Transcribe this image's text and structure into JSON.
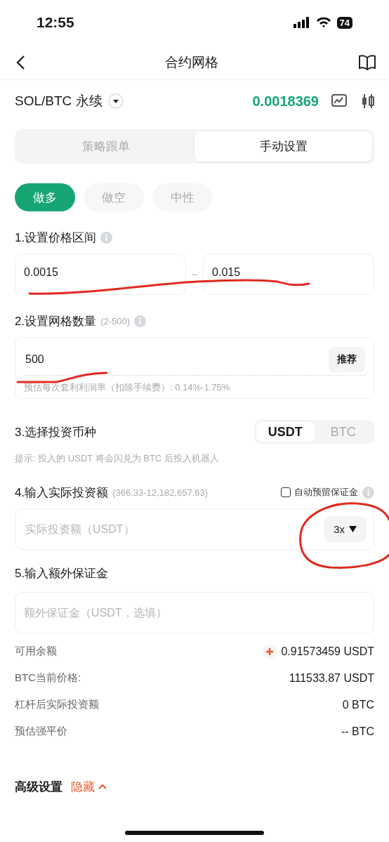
{
  "status_bar": {
    "time": "12:55",
    "battery": "74"
  },
  "nav": {
    "title": "合约网格"
  },
  "pair": {
    "symbol": "SOL/BTC 永续",
    "price": "0.0018369"
  },
  "mode_tabs": [
    {
      "label": "策略跟单",
      "selected": false
    },
    {
      "label": "手动设置",
      "selected": true
    }
  ],
  "directions": [
    {
      "label": "做多",
      "selected": true
    },
    {
      "label": "做空",
      "selected": false
    },
    {
      "label": "中性",
      "selected": false
    }
  ],
  "price_range": {
    "label": "1.设置价格区间",
    "lower": "0.0015",
    "separator": "~",
    "upper": "0.015"
  },
  "grid_count": {
    "label": "2.设置网格数量",
    "range": "(2-500)",
    "value": "500",
    "button": "推荐",
    "hint": "预估每次套利利润率（扣除手续费）: 0.14%-1.75%"
  },
  "currency": {
    "label": "3.选择投资币种",
    "options": [
      {
        "label": "USDT",
        "selected": true
      },
      {
        "label": "BTC",
        "selected": false
      }
    ],
    "hint": "提示: 投入的 USDT 将会闪兑为 BTC 后投入机器人"
  },
  "investment": {
    "label": "4.输入实际投资额",
    "range": "(366.33-12,182,657.63)",
    "auto_margin": {
      "label": "自动预留保证金",
      "checked": false
    },
    "placeholder": "实际投资额（USDT）",
    "leverage": "3x"
  },
  "extra_margin": {
    "label": "5.输入额外保证金",
    "placeholder": "额外保证金（USDT，选填）"
  },
  "summary": [
    {
      "label": "可用余额",
      "value": "0.91573459 USDT",
      "kind": "add"
    },
    {
      "label": "BTC当前价格:",
      "value": "111533.87 USDT",
      "kind": "plain"
    },
    {
      "label": "杠杆后实际投资额",
      "value": "0 BTC",
      "kind": "plain"
    },
    {
      "label": "预估强平价",
      "value": "-- BTC",
      "kind": "plain"
    }
  ],
  "advanced": {
    "label": "高级设置",
    "toggle": "隐藏",
    "expanded": true
  },
  "markup": [
    {
      "kind": "underline"
    },
    {
      "kind": "underline"
    },
    {
      "kind": "circle"
    }
  ]
}
